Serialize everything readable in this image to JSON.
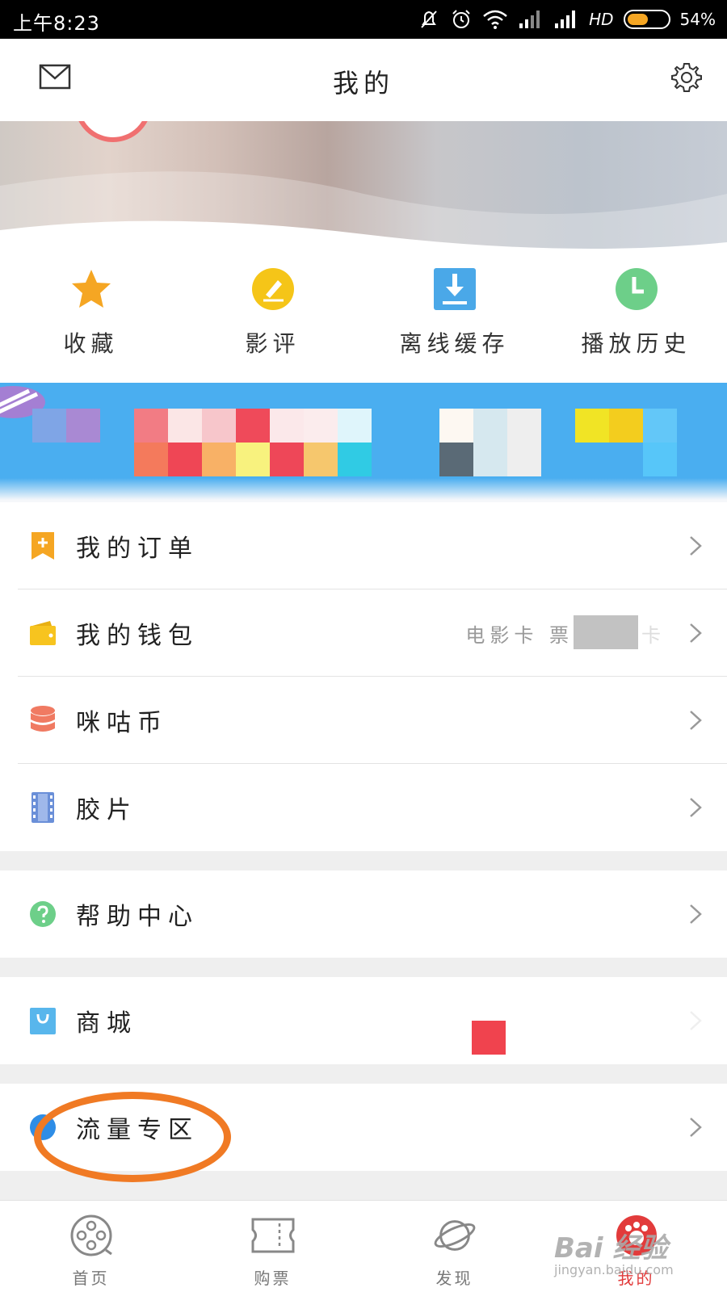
{
  "status_bar": {
    "time": "上午8:23",
    "network": "HD",
    "battery": "54%",
    "battery_level": 0.54
  },
  "header": {
    "title": "我的",
    "mail_icon": "mail-icon",
    "settings_icon": "gear-icon"
  },
  "quick_actions": [
    {
      "label": "收藏",
      "icon": "star-icon",
      "color": "#f5a623"
    },
    {
      "label": "影评",
      "icon": "pencil-icon",
      "color": "#f5c518"
    },
    {
      "label": "离线缓存",
      "icon": "download-icon",
      "color": "#4aa8e8"
    },
    {
      "label": "播放历史",
      "icon": "clock-icon",
      "color": "#6dcf89"
    }
  ],
  "menu_groups": [
    [
      {
        "label": "我的订单",
        "icon": "order-icon",
        "color": "#f5a623"
      },
      {
        "label": "我的钱包",
        "icon": "wallet-icon",
        "color": "#f7c41f",
        "value": "电影卡 票",
        "value_suffix": "卡"
      },
      {
        "label": "咪咕币",
        "icon": "coins-icon",
        "color": "#f07a62"
      },
      {
        "label": "胶片",
        "icon": "film-icon",
        "color": "#6a8fd8"
      }
    ],
    [
      {
        "label": "帮助中心",
        "icon": "help-icon",
        "color": "#6dcf89"
      }
    ],
    [
      {
        "label": "商城",
        "icon": "shopping-bag-icon",
        "color": "#58b6ec"
      }
    ],
    [
      {
        "label": "流量专区",
        "icon": "data-zone-icon",
        "color": "#2e8de6"
      }
    ]
  ],
  "tab_bar": [
    {
      "label": "首页",
      "icon": "film-reel-icon",
      "active": false
    },
    {
      "label": "购票",
      "icon": "ticket-icon",
      "active": false
    },
    {
      "label": "发现",
      "icon": "planet-icon",
      "active": false
    },
    {
      "label": "我的",
      "icon": "profile-icon",
      "active": true
    }
  ],
  "watermark": {
    "logo": "Bai 经验",
    "url": "jingyan.baidu.com"
  },
  "colors": {
    "accent_red": "#e23b3b",
    "annotation_orange": "#f07a24"
  }
}
